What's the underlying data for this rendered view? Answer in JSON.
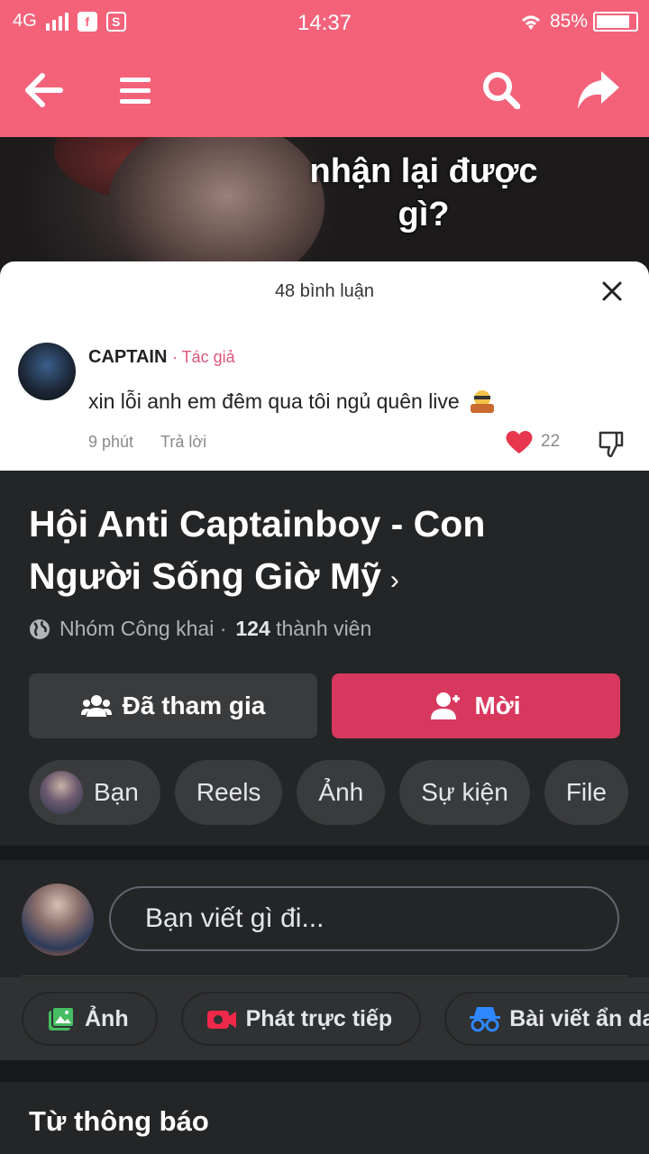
{
  "status_bar": {
    "network": "4G",
    "time": "14:37",
    "battery": "85%",
    "battery_level": 0.85
  },
  "nav": {
    "back_icon": "arrow-left-icon",
    "menu_icon": "hamburger-icon",
    "search_icon": "search-icon",
    "share_icon": "share-arrow-icon",
    "accent": "#f4627a"
  },
  "cover": {
    "caption_line1": "nhận lại được",
    "caption_line2": "gì?",
    "sheet_title": "48 bình luận",
    "comment": {
      "name": "CAPTAIN",
      "author_tag": "· Tác giả",
      "text": "xin lỗi anh em đêm qua tôi ngủ quên live",
      "time": "9 phút",
      "reply": "Trả lời",
      "likes": "22"
    }
  },
  "group": {
    "title_line1": "Hội Anti Captainboy - Con",
    "title_line2": "Người Sống Giờ Mỹ",
    "privacy": "Nhóm Công khai ·",
    "member_count": "124",
    "member_label": "thành viên",
    "joined_label": "Đã tham gia",
    "invite_label": "Mời",
    "invite_color": "#d8385e"
  },
  "tabs": [
    "Bạn",
    "Reels",
    "Ảnh",
    "Sự kiện",
    "File"
  ],
  "composer": {
    "placeholder": "Bạn viết gì đi..."
  },
  "actions": {
    "photo": "Ảnh",
    "live": "Phát trực tiếp",
    "anonymous": "Bài viết ẩn dan"
  },
  "section": {
    "title": "Từ thông báo"
  }
}
